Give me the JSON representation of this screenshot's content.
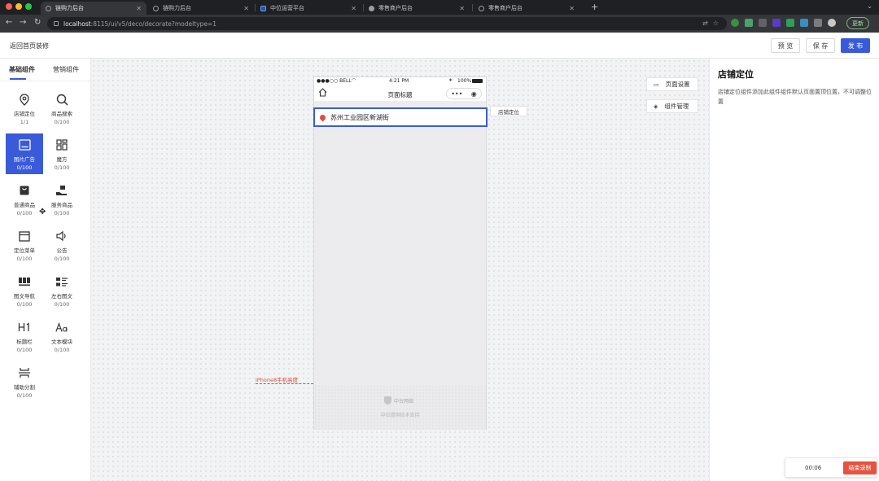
{
  "browser": {
    "tabs": [
      {
        "title": "链购力后台",
        "active": true
      },
      {
        "title": "链购力后台",
        "active": false
      },
      {
        "title": "中位运营平台",
        "active": false
      },
      {
        "title": "零售商户后台",
        "active": false
      },
      {
        "title": "零售商户后台",
        "active": false
      }
    ],
    "new_tab": "+",
    "url_host": "localhost",
    "url_path": ":8115/ui/v5/deco/decorate?modeltype=1",
    "update_label": "更新",
    "traffic_colors": [
      "#ff5f57",
      "#febc2e",
      "#28c840"
    ]
  },
  "header": {
    "back_label": "返回首页装修",
    "preview_label": "预 览",
    "save_label": "保 存",
    "publish_label": "发 布",
    "accent": "#3a5bd9"
  },
  "sidebar": {
    "tabs": [
      {
        "label": "基础组件",
        "active": true
      },
      {
        "label": "营销组件",
        "active": false
      }
    ],
    "components": [
      {
        "icon": "map-pin-icon",
        "name": "店铺定位",
        "count": "1/1",
        "active": false
      },
      {
        "icon": "search-icon",
        "name": "商品搜索",
        "count": "0/100",
        "active": false
      },
      {
        "icon": "image-ad-icon",
        "name": "图片广告",
        "count": "0/100",
        "active": true
      },
      {
        "icon": "grid-icon",
        "name": "魔方",
        "count": "0/100",
        "active": false
      },
      {
        "icon": "bag-icon",
        "name": "普通商品",
        "count": "0/100",
        "active": false
      },
      {
        "icon": "service-icon",
        "name": "服务商品",
        "count": "0/100",
        "active": false
      },
      {
        "icon": "menu-icon",
        "name": "定位菜单",
        "count": "0/100",
        "active": false
      },
      {
        "icon": "speaker-icon",
        "name": "公告",
        "count": "0/100",
        "active": false
      },
      {
        "icon": "image-nav-icon",
        "name": "图文导航",
        "count": "0/100",
        "active": false
      },
      {
        "icon": "list-icon",
        "name": "左右图文",
        "count": "0/100",
        "active": false
      },
      {
        "icon": "heading-icon",
        "name": "标题栏",
        "count": "0/100",
        "active": false
      },
      {
        "icon": "text-icon",
        "name": "文本模块",
        "count": "0/100",
        "active": false
      },
      {
        "icon": "divider-icon",
        "name": "辅助分割",
        "count": "0/100",
        "active": false
      }
    ]
  },
  "phone": {
    "carrier": "●●●○○ BELL",
    "time": "4:21 PM",
    "battery": "100%",
    "page_title": "页面标题",
    "location_text": "苏州工业园区新湖街",
    "location_tag": "店铺定位",
    "iphone_label": "iPhone8手机高度",
    "footer_brand": "中台网络",
    "footer_text": "中位提供技术支持"
  },
  "canvas_buttons": {
    "page_settings": "页面设置",
    "component_manage": "组件管理"
  },
  "right_panel": {
    "title": "店铺定位",
    "description": "店铺定位组件添加此组件组件默认页面置顶位置，不可调整位置"
  },
  "recording": {
    "time": "00:06",
    "stop_label": "结束录制"
  }
}
